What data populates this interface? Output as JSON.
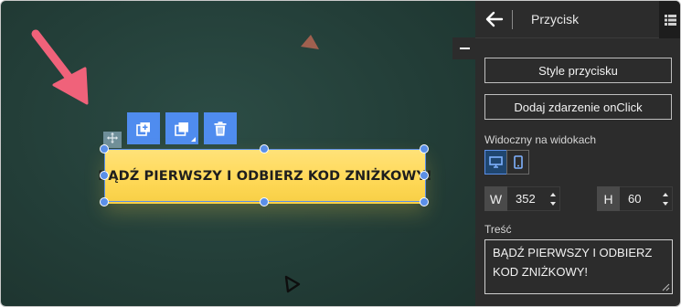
{
  "panel": {
    "title": "Przycisk",
    "button_styles": "Style przycisku",
    "button_onclick": "Dodaj zdarzenie onClick",
    "visibility_label": "Widoczny na widokach",
    "width_label": "W",
    "width_value": "352",
    "height_label": "H",
    "height_value": "60",
    "content_label": "Treść",
    "content_value": "BĄDŹ PIERWSZY I ODBIERZ KOD ZNIŻKOWY!"
  },
  "canvas": {
    "cta_text": "BĄDŹ PIERWSZY I ODBIERZ KOD ZNIŻKOWY!"
  },
  "icons": {
    "toolbar": [
      "duplicate-icon",
      "layer-order-icon",
      "trash-icon"
    ],
    "devices": [
      "desktop-icon",
      "mobile-icon"
    ],
    "header": [
      "back-arrow-icon",
      "list-icon"
    ],
    "move": "move-icon"
  },
  "colors": {
    "canvas_bg": "#233e38",
    "panel_bg": "#2c2c2c",
    "accent_blue": "#4f8cef",
    "cta_yellow": "#ffd958",
    "arrow_pink": "#f0627a"
  }
}
